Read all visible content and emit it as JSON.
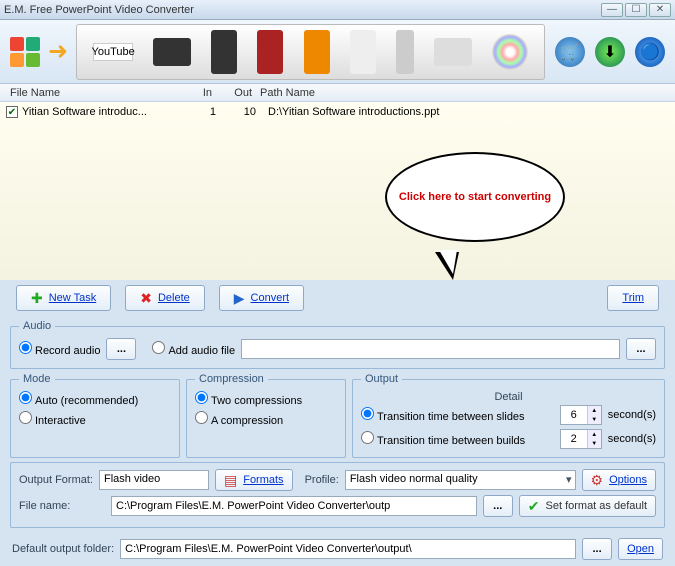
{
  "window": {
    "title": "E.M. Free PowerPoint Video Converter"
  },
  "list": {
    "headers": {
      "file": "File Name",
      "in": "In",
      "out": "Out",
      "path": "Path Name"
    },
    "row": {
      "file": "Yitian Software introduc...",
      "in": "1",
      "out": "10",
      "path": "D:\\Yitian Software introductions.ppt"
    }
  },
  "callout": "Click here to start converting",
  "buttons": {
    "new_task": "New Task",
    "delete": "Delete",
    "convert": "Convert",
    "trim": "Trim",
    "formats": "Formats",
    "options": "Options",
    "set_default": "Set format as default",
    "open": "Open"
  },
  "audio": {
    "legend": "Audio",
    "record": "Record audio",
    "add_file": "Add audio file",
    "path": ""
  },
  "mode": {
    "legend": "Mode",
    "auto": "Auto (recommended)",
    "interactive": "Interactive"
  },
  "compression": {
    "legend": "Compression",
    "two": "Two compressions",
    "one": "A compression"
  },
  "output": {
    "legend": "Output",
    "detail": "Detail",
    "trans_slides": "Transition time between slides",
    "trans_slides_val": "6",
    "trans_builds": "Transition time between builds",
    "trans_builds_val": "2",
    "seconds": "second(s)"
  },
  "format": {
    "output_format_lbl": "Output Format:",
    "output_format_val": "Flash video",
    "profile_lbl": "Profile:",
    "profile_val": "Flash video normal quality",
    "filename_lbl": "File name:",
    "filename_val": "C:\\Program Files\\E.M. PowerPoint Video Converter\\outp"
  },
  "footer": {
    "default_folder_lbl": "Default output folder:",
    "default_folder_val": "C:\\Program Files\\E.M. PowerPoint Video Converter\\output\\"
  },
  "yt": "YouTube"
}
